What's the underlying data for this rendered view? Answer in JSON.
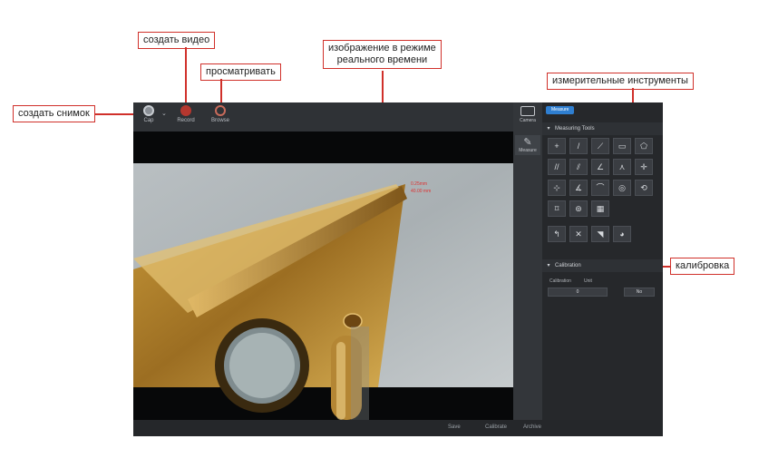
{
  "callouts": {
    "snapshot": "создать снимок",
    "video": "создать видео",
    "browse": "просматривать",
    "live_image_line1": "изображение в режиме",
    "live_image_line2": "реального времени",
    "measuring_tools": "измерительные инструменты",
    "calibration": "калибровка"
  },
  "toolbar": {
    "capture_label": "Cap",
    "record_label": "Record",
    "browse_label": "Browse"
  },
  "sidebar": {
    "camera_label": "Camera",
    "measure_label": "Measure"
  },
  "panel": {
    "tag": "Measure",
    "measuring_tools_title": "Measuring Tools",
    "calibration_title": "Calibration",
    "calibration_field_label": "Calibration",
    "calibration_unit": "Unit",
    "calibration_value": "0",
    "calibration_select": "No"
  },
  "bottombar": {
    "item1": "Save",
    "item2": "Calibrate",
    "item3": "Archive"
  },
  "overlay_text": {
    "line1": "0.25mm",
    "line2": "40.00 mm"
  },
  "tools": [
    {
      "icon": "point-icon",
      "glyph": "+"
    },
    {
      "icon": "line-icon",
      "glyph": "/"
    },
    {
      "icon": "polyline-icon",
      "glyph": "⟋"
    },
    {
      "icon": "rectangle-icon",
      "glyph": "▭"
    },
    {
      "icon": "polygon-icon",
      "glyph": "⬠"
    },
    {
      "icon": "parallel-lines-icon",
      "glyph": "//"
    },
    {
      "icon": "double-line-icon",
      "glyph": "⫽"
    },
    {
      "icon": "angle-icon",
      "glyph": "∠"
    },
    {
      "icon": "arc-angle-icon",
      "glyph": "⋏"
    },
    {
      "icon": "crosshair-icon",
      "glyph": "✛"
    },
    {
      "icon": "grid-icon",
      "glyph": "⊹"
    },
    {
      "icon": "angle-measure-icon",
      "glyph": "∡"
    },
    {
      "icon": "arc-icon",
      "glyph": "⌒"
    },
    {
      "icon": "circle-icon",
      "glyph": "◎"
    },
    {
      "icon": "rotate-icon",
      "glyph": "⟲"
    },
    {
      "icon": "frame-icon",
      "glyph": "⌑"
    },
    {
      "icon": "concentric-icon",
      "glyph": "⊚"
    },
    {
      "icon": "table-icon",
      "glyph": "▦"
    },
    {
      "icon": "pointer-icon",
      "glyph": "↰"
    },
    {
      "icon": "delete-icon",
      "glyph": "✕"
    },
    {
      "icon": "fill-icon",
      "glyph": "◥"
    },
    {
      "icon": "color-icon",
      "glyph": "◕"
    }
  ]
}
